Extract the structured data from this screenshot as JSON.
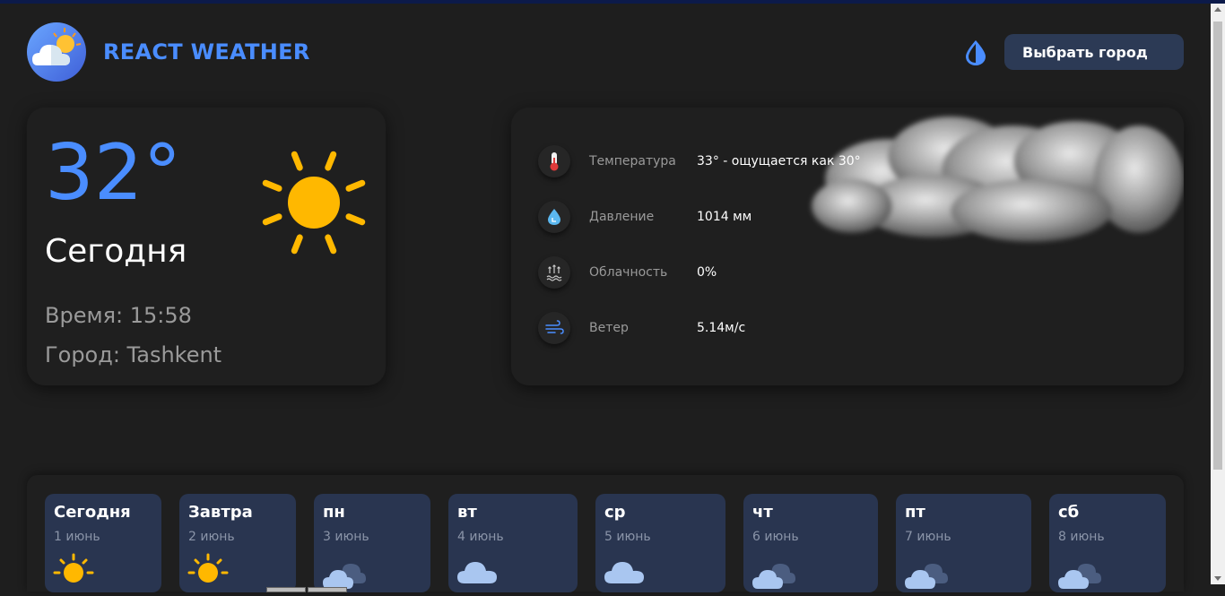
{
  "header": {
    "brand": "REACT WEATHER",
    "city_button": "Выбрать город",
    "logo_icon": "cloud-sun-logo-icon",
    "theme_icon": "water-drop-icon"
  },
  "today": {
    "temperature": "32°",
    "label": "Сегодня",
    "time": "Время: 15:58",
    "city": "Город: Tashkent",
    "icon": "sun-icon"
  },
  "details": [
    {
      "icon": "thermometer-icon",
      "label": "Температура",
      "value": "33° - ощущается как 30°"
    },
    {
      "icon": "pressure-drop-icon",
      "label": "Давление",
      "value": "1014 мм"
    },
    {
      "icon": "cloudiness-icon",
      "label": "Облачность",
      "value": "0%"
    },
    {
      "icon": "wind-icon",
      "label": "Ветер",
      "value": "5.14м/с"
    }
  ],
  "week": [
    {
      "day": "Сегодня",
      "date": "1 июнь",
      "icon": "sun-icon"
    },
    {
      "day": "Завтра",
      "date": "2 июнь",
      "icon": "sun-icon"
    },
    {
      "day": "пн",
      "date": "3 июнь",
      "icon": "cloudy-icon"
    },
    {
      "day": "вт",
      "date": "4 июнь",
      "icon": "cloud-icon"
    },
    {
      "day": "ср",
      "date": "5 июнь",
      "icon": "cloud-icon"
    },
    {
      "day": "чт",
      "date": "6 июнь",
      "icon": "cloudy-icon"
    },
    {
      "day": "пт",
      "date": "7 июнь",
      "icon": "cloudy-icon"
    },
    {
      "day": "сб",
      "date": "8 июнь",
      "icon": "cloudy-icon"
    }
  ],
  "colors": {
    "accent": "#4a8dff",
    "background": "#1e1e1e",
    "card": "#1f1f1f",
    "day_card": "#293550",
    "button": "#2c3a55",
    "sun": "#ffb800"
  }
}
